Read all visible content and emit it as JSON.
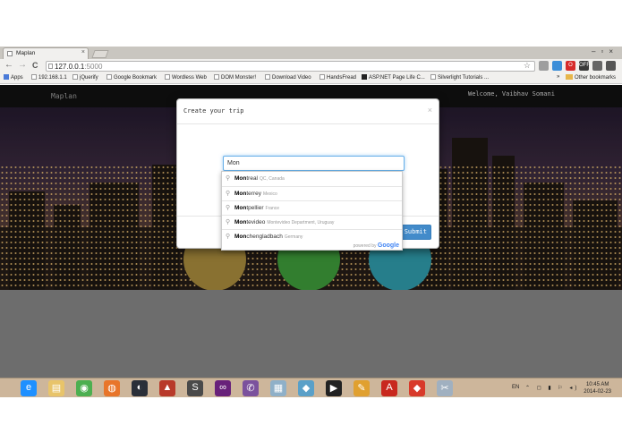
{
  "browser": {
    "tab_title": "Maplan",
    "tab_close": "×",
    "window_controls": "–▫×",
    "url_host": "127.0.0.1",
    "url_port": ":5000",
    "back": "←",
    "forward": "→",
    "reload": "C",
    "star": "☆",
    "extensions": [
      {
        "label": "",
        "color": "#9e9e9e"
      },
      {
        "label": "",
        "color": "#3c8ed8"
      },
      {
        "label": "O",
        "color": "#d62b2b"
      },
      {
        "label": "OFF",
        "color": "#3a3a3a"
      },
      {
        "label": "",
        "color": "#666666"
      },
      {
        "label": "",
        "color": "#555555"
      }
    ],
    "bookmarks": [
      "Apps",
      "192.168.1.1",
      "jQuerify",
      "Google Bookmark",
      "Wordless Web",
      "DOM Monster!",
      "Download Video",
      "HandsFread",
      "ASP.NET Page Life C...",
      "Silverlight Tutorials ...",
      "»",
      "Other bookmarks"
    ]
  },
  "page": {
    "brand": "Maplan",
    "welcome": "Welcome, Vaibhav Somani",
    "circle_colors": [
      "#a88a3c",
      "#3e9a3a",
      "#2f9aaa"
    ]
  },
  "modal": {
    "title": "Create your trip",
    "close": "×",
    "input_value": "Mon",
    "submit_label": "Submit"
  },
  "autocomplete": {
    "items": [
      {
        "match": "Mon",
        "rest": "treal",
        "secondary": "QC, Canada"
      },
      {
        "match": "Mon",
        "rest": "terrey",
        "secondary": "Mexico"
      },
      {
        "match": "Mon",
        "rest": "tpellier",
        "secondary": "France"
      },
      {
        "match": "Mon",
        "rest": "tevideo",
        "secondary": "Montevideo Department, Uruguay"
      },
      {
        "match": "Mon",
        "rest": "chengladbach",
        "secondary": "Germany"
      }
    ],
    "powered_by": "powered by",
    "google": "Google"
  },
  "taskbar": {
    "language": "EN",
    "time": "10:45 AM",
    "date": "2014-02-23",
    "apps": [
      {
        "name": "ie",
        "color": "#1e90ff",
        "glyph": "e"
      },
      {
        "name": "explorer",
        "color": "#e8c46a",
        "glyph": "▤"
      },
      {
        "name": "chrome",
        "color": "#4caf50",
        "glyph": "◉"
      },
      {
        "name": "firefox",
        "color": "#e8752a",
        "glyph": "◍"
      },
      {
        "name": "steam",
        "color": "#2a2f38",
        "glyph": "◐"
      },
      {
        "name": "app5",
        "color": "#b83a2a",
        "glyph": "▲"
      },
      {
        "name": "sublime",
        "color": "#4a4a4a",
        "glyph": "S"
      },
      {
        "name": "visual-studio",
        "color": "#68217a",
        "glyph": "∞"
      },
      {
        "name": "viber",
        "color": "#7b519d",
        "glyph": "✆"
      },
      {
        "name": "app9",
        "color": "#8fb0c8",
        "glyph": "▦"
      },
      {
        "name": "app10",
        "color": "#5aa0c8",
        "glyph": "◆"
      },
      {
        "name": "media",
        "color": "#222222",
        "glyph": "▶"
      },
      {
        "name": "app12",
        "color": "#e0a030",
        "glyph": "✎"
      },
      {
        "name": "acrobat",
        "color": "#c8281e",
        "glyph": "A"
      },
      {
        "name": "app14",
        "color": "#d83a2a",
        "glyph": "◆"
      },
      {
        "name": "app15",
        "color": "#a0b0c0",
        "glyph": "✂"
      }
    ]
  }
}
